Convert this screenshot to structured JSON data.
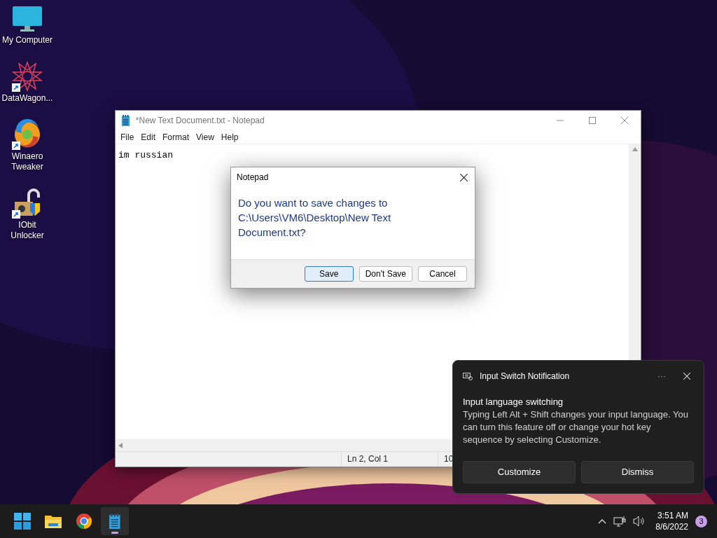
{
  "desktop_icons": [
    {
      "label": "My Computer",
      "kind": "monitor",
      "shortcut": false
    },
    {
      "label": "DataWagon...",
      "kind": "star",
      "shortcut": true
    },
    {
      "label": "Winaero Tweaker",
      "kind": "swirl",
      "shortcut": true
    },
    {
      "label": "IObit Unlocker",
      "kind": "lock",
      "shortcut": true
    }
  ],
  "notepad": {
    "title": "*New Text Document.txt - Notepad",
    "menu": [
      "File",
      "Edit",
      "Format",
      "View",
      "Help"
    ],
    "content": "im russian",
    "status": [
      "Ln 2, Col 1",
      "10"
    ]
  },
  "dialog": {
    "title": "Notepad",
    "message": "Do you want to save changes to C:\\Users\\VM6\\Desktop\\New Text Document.txt?",
    "buttons": [
      {
        "label": "Save",
        "default": true
      },
      {
        "label": "Don't Save",
        "default": false
      },
      {
        "label": "Cancel",
        "default": false
      }
    ]
  },
  "notification": {
    "app": "Input Switch Notification",
    "more": "···",
    "heading": "Input language switching",
    "body": "Typing Left Alt + Shift changes your input language. You can turn this feature off or change your hot key sequence by selecting Customize.",
    "buttons": [
      "Customize",
      "Dismiss"
    ]
  },
  "taskbar": {
    "apps": [
      {
        "kind": "start",
        "selected": false
      },
      {
        "kind": "folder",
        "selected": false
      },
      {
        "kind": "chrome",
        "selected": false
      },
      {
        "kind": "notepad",
        "selected": true
      }
    ],
    "time": "3:51 AM",
    "date": "8/6/2022",
    "badge": "3"
  }
}
